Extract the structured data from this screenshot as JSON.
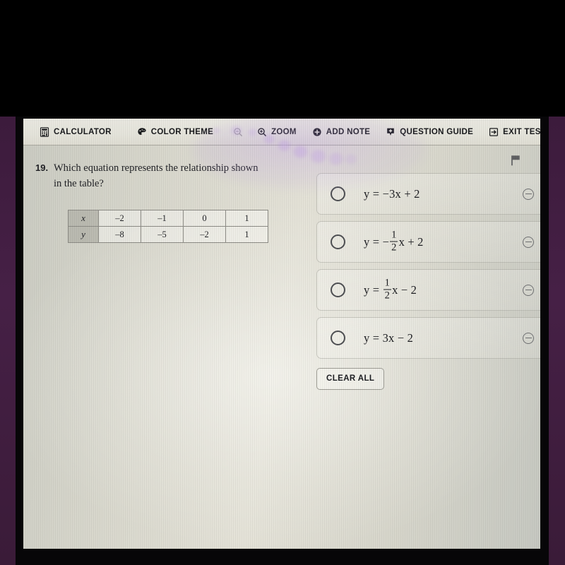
{
  "toolbar": {
    "items": [
      {
        "label": "CALCULATOR",
        "icon": "calculator-icon"
      },
      {
        "label": "COLOR THEME",
        "icon": "palette-icon"
      },
      {
        "label": "",
        "icon": "zoom-out-icon"
      },
      {
        "label": "ZOOM",
        "icon": "zoom-in-icon"
      },
      {
        "label": "ADD NOTE",
        "icon": "add-note-plus-icon"
      },
      {
        "label": "QUESTION GUIDE",
        "icon": "question-guide-icon"
      },
      {
        "label": "EXIT TEST",
        "icon": "exit-arrow-icon"
      }
    ]
  },
  "question": {
    "number": "19.",
    "text": "Which equation represents the relationship shown in the table?",
    "flag_icon": "flag-icon"
  },
  "table": {
    "rows": [
      {
        "header": "x",
        "values": [
          "–2",
          "–1",
          "0",
          "1"
        ]
      },
      {
        "header": "y",
        "values": [
          "–8",
          "–5",
          "–2",
          "1"
        ]
      }
    ]
  },
  "options": [
    {
      "id": "A",
      "selected": false,
      "lead": "y = −3x + 2",
      "fraction": null,
      "tail": "",
      "eliminate_icon": "eliminate-circle-minus-icon"
    },
    {
      "id": "B",
      "selected": false,
      "lead": "y = −",
      "fraction": {
        "num": "1",
        "den": "2"
      },
      "tail": "x + 2",
      "eliminate_icon": "eliminate-circle-minus-icon"
    },
    {
      "id": "C",
      "selected": false,
      "lead": "y = ",
      "fraction": {
        "num": "1",
        "den": "2"
      },
      "tail": "x − 2",
      "eliminate_icon": "eliminate-circle-minus-icon"
    },
    {
      "id": "D",
      "selected": false,
      "lead": "y = 3x − 2",
      "fraction": null,
      "tail": "",
      "eliminate_icon": "eliminate-circle-minus-icon"
    }
  ],
  "actions": {
    "clear_all_label": "CLEAR ALL"
  },
  "colors": {
    "screen_light": "#e3e1d6",
    "screen_dark": "#c5c7c0",
    "toolbar_bg": "#e6e5dc",
    "text": "#1a1b1f",
    "rule": "#a8a79e",
    "glare_purple": "#c4a0ee",
    "bezel": "#070608",
    "surround_purple": "#462046"
  }
}
